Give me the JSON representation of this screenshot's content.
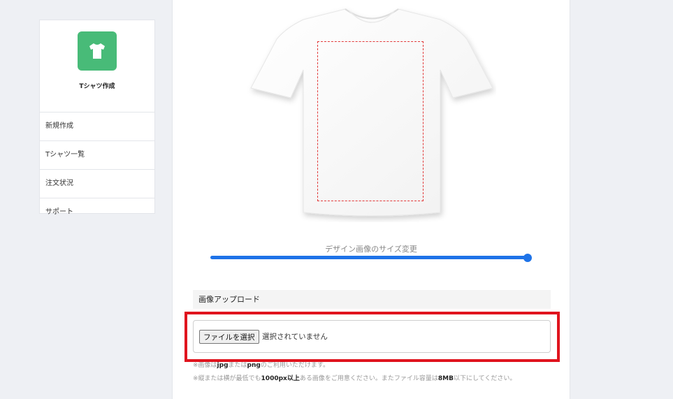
{
  "brand": {
    "name": "Tシャツ作成",
    "logo_icon": "tshirt-icon",
    "logo_color": "#48bb78"
  },
  "sidebar": {
    "items": [
      {
        "label": "新規作成"
      },
      {
        "label": "Tシャツ一覧"
      },
      {
        "label": "注文状況"
      },
      {
        "label": "サポート"
      }
    ]
  },
  "designer": {
    "slider_label": "デザイン画像のサイズ変更",
    "slider_value": 1.0,
    "accent_color": "#1e73e8"
  },
  "upload": {
    "heading": "画像アップロード",
    "button_label": "ファイルを選択",
    "status": "選択されていません",
    "note1": {
      "p1": "※画像は",
      "b1": "jpg",
      "p2": "または",
      "b2": "png",
      "p3": "のご利用いただけます。"
    },
    "note2": {
      "p1": "※縦または横が最低でも",
      "b1": "1000px以上",
      "p2": "ある画像をご用意ください。またファイル容量は",
      "b2": "8MB",
      "p3": "以下にしてください。"
    },
    "highlight_color": "#e0141e"
  }
}
